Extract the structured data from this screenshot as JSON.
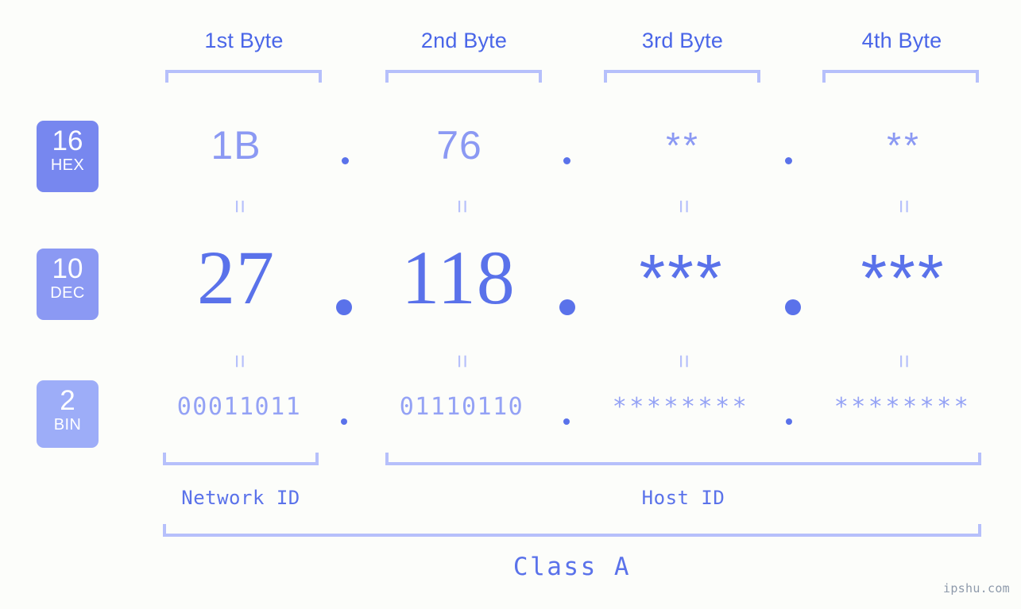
{
  "meta": {
    "background_color": "#fcfdfa",
    "accent_color": "#5a72ea",
    "light_accent_color": "#b6c0fb",
    "watermark": "ipshu.com"
  },
  "header": {
    "byte_labels": [
      "1st Byte",
      "2nd Byte",
      "3rd Byte",
      "4th Byte"
    ]
  },
  "radix_badges": [
    {
      "number": "16",
      "system": "HEX",
      "color": "#7787ef"
    },
    {
      "number": "10",
      "system": "DEC",
      "color": "#8b99f3"
    },
    {
      "number": "2",
      "system": "BIN",
      "color": "#9dadf8"
    }
  ],
  "rows": {
    "hex": {
      "label": "HEX",
      "values": [
        "1B",
        "76",
        "**",
        "**"
      ],
      "separator": "."
    },
    "dec": {
      "label": "DEC",
      "values": [
        "27",
        "118",
        "***",
        "***"
      ],
      "separator": "."
    },
    "bin": {
      "label": "BIN",
      "values": [
        "00011011",
        "01110110",
        "********",
        "********"
      ],
      "separator": "."
    }
  },
  "equivalence_symbol": "=",
  "footer": {
    "network_id_label": "Network ID",
    "host_id_label": "Host ID",
    "class_label": "Class A"
  }
}
